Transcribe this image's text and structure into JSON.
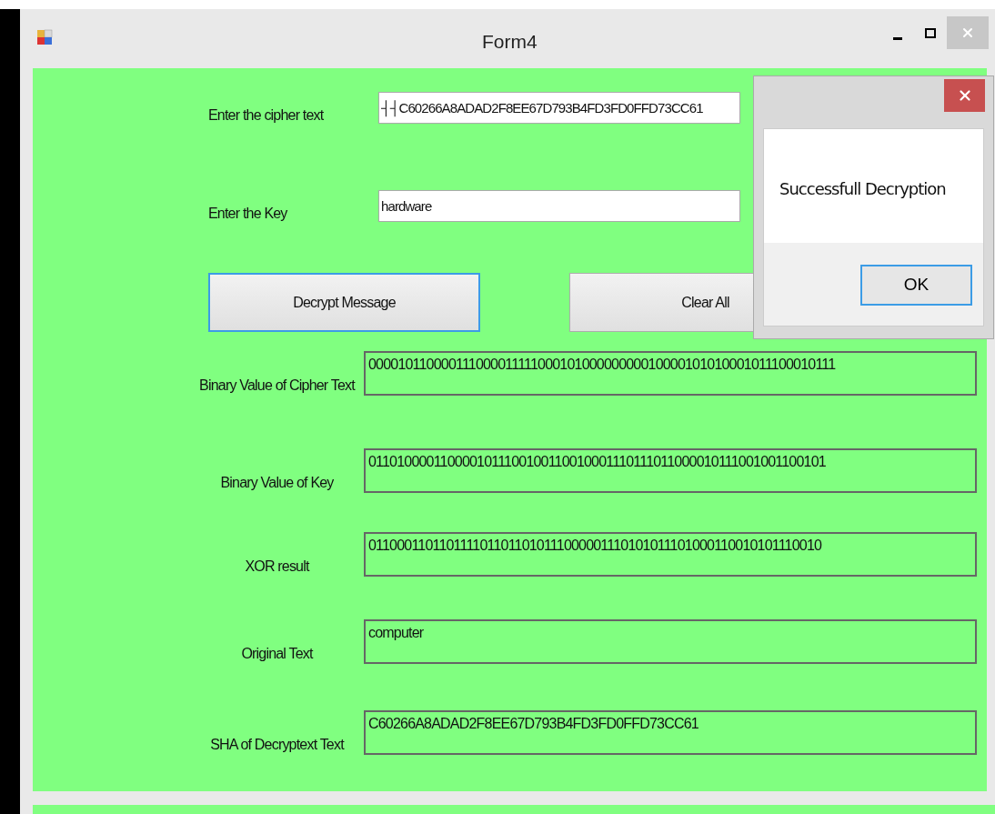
{
  "window": {
    "title": "Form4"
  },
  "inputs": [
    {
      "label": "Enter the cipher text",
      "value": "┤┤C60266A8ADAD2F8EE67D793B4FD3FD0FFD73CC61"
    },
    {
      "label": "Enter the Key",
      "value": "hardware"
    }
  ],
  "buttons": [
    {
      "label": "Decrypt Message",
      "focused": true
    },
    {
      "label": "Clear All",
      "focused": false
    }
  ],
  "outputs": [
    {
      "label": "Binary Value of Cipher Text",
      "value": "00001011000011100001111100010100000000010000101010001011100010111"
    },
    {
      "label": "Binary Value of Key",
      "value": "0110100001100001011100100110010001110111011000010111001001100101"
    },
    {
      "label": "XOR result",
      "value": "0110001101101111011011010111000001110101011101000110010101110010"
    },
    {
      "label": "Original Text",
      "value": "computer"
    },
    {
      "label": "SHA of Decryptext Text",
      "value": "C60266A8ADAD2F8EE67D793B4FD3FD0FFD73CC61"
    }
  ],
  "dialog": {
    "message": "Successfull Decryption",
    "button": "OK"
  }
}
